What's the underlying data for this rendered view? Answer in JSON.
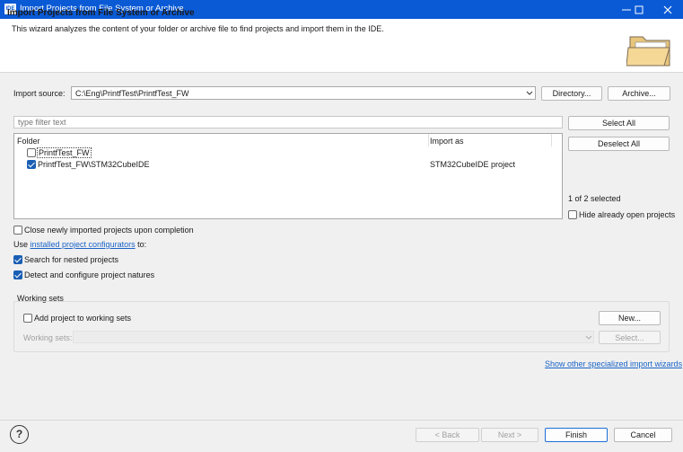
{
  "window": {
    "app_icon_text": "IDE",
    "title": "Import Projects from File System or Archive",
    "minimize_icon": "minimize-icon",
    "maximize_icon": "maximize-icon",
    "close_icon": "close-icon"
  },
  "header": {
    "title": "Import Projects from File System or Archive",
    "description": "This wizard analyzes the content of your folder or archive file to find projects and import them in the IDE.",
    "graphic_icon": "open-folder-icon"
  },
  "import_source": {
    "label": "Import source:",
    "value": "C:\\Eng\\PrintfTest\\PrintfTest_FW",
    "directory_label": "Directory...",
    "archive_label": "Archive..."
  },
  "filter": {
    "placeholder": "type filter text"
  },
  "table": {
    "columns": [
      "Folder",
      "Import as"
    ],
    "rows": [
      {
        "folder": "PrintfTest_FW",
        "import_as": "",
        "checked": false
      },
      {
        "folder": "PrintfTest_FW\\STM32CubeIDE",
        "import_as": "STM32CubeIDE project",
        "checked": true
      }
    ]
  },
  "side": {
    "select_all_label": "Select All",
    "deselect_all_label": "Deselect All",
    "selection_count": "1 of 2 selected",
    "hide_open_label": "Hide already open projects"
  },
  "options": {
    "close_imported_label": "Close newly imported projects upon completion",
    "use_prefix": "Use ",
    "configurators_link": "installed project configurators",
    "use_suffix": " to:",
    "search_nested_label": "Search for nested projects",
    "detect_natures_label": "Detect and configure project natures"
  },
  "working_sets": {
    "group_label": "Working sets",
    "add_label": "Add project to working sets",
    "new_label": "New...",
    "sets_label": "Working sets:",
    "select_label": "Select..."
  },
  "specialized_link": "Show other specialized import wizards",
  "footer": {
    "help_icon_text": "?",
    "back_label": "< Back",
    "next_label": "Next >",
    "finish_label": "Finish",
    "cancel_label": "Cancel"
  },
  "colors": {
    "titlebar": "#0a5ad6",
    "link": "#1a64c8",
    "checkbox_checked": "#1a5fb4"
  }
}
